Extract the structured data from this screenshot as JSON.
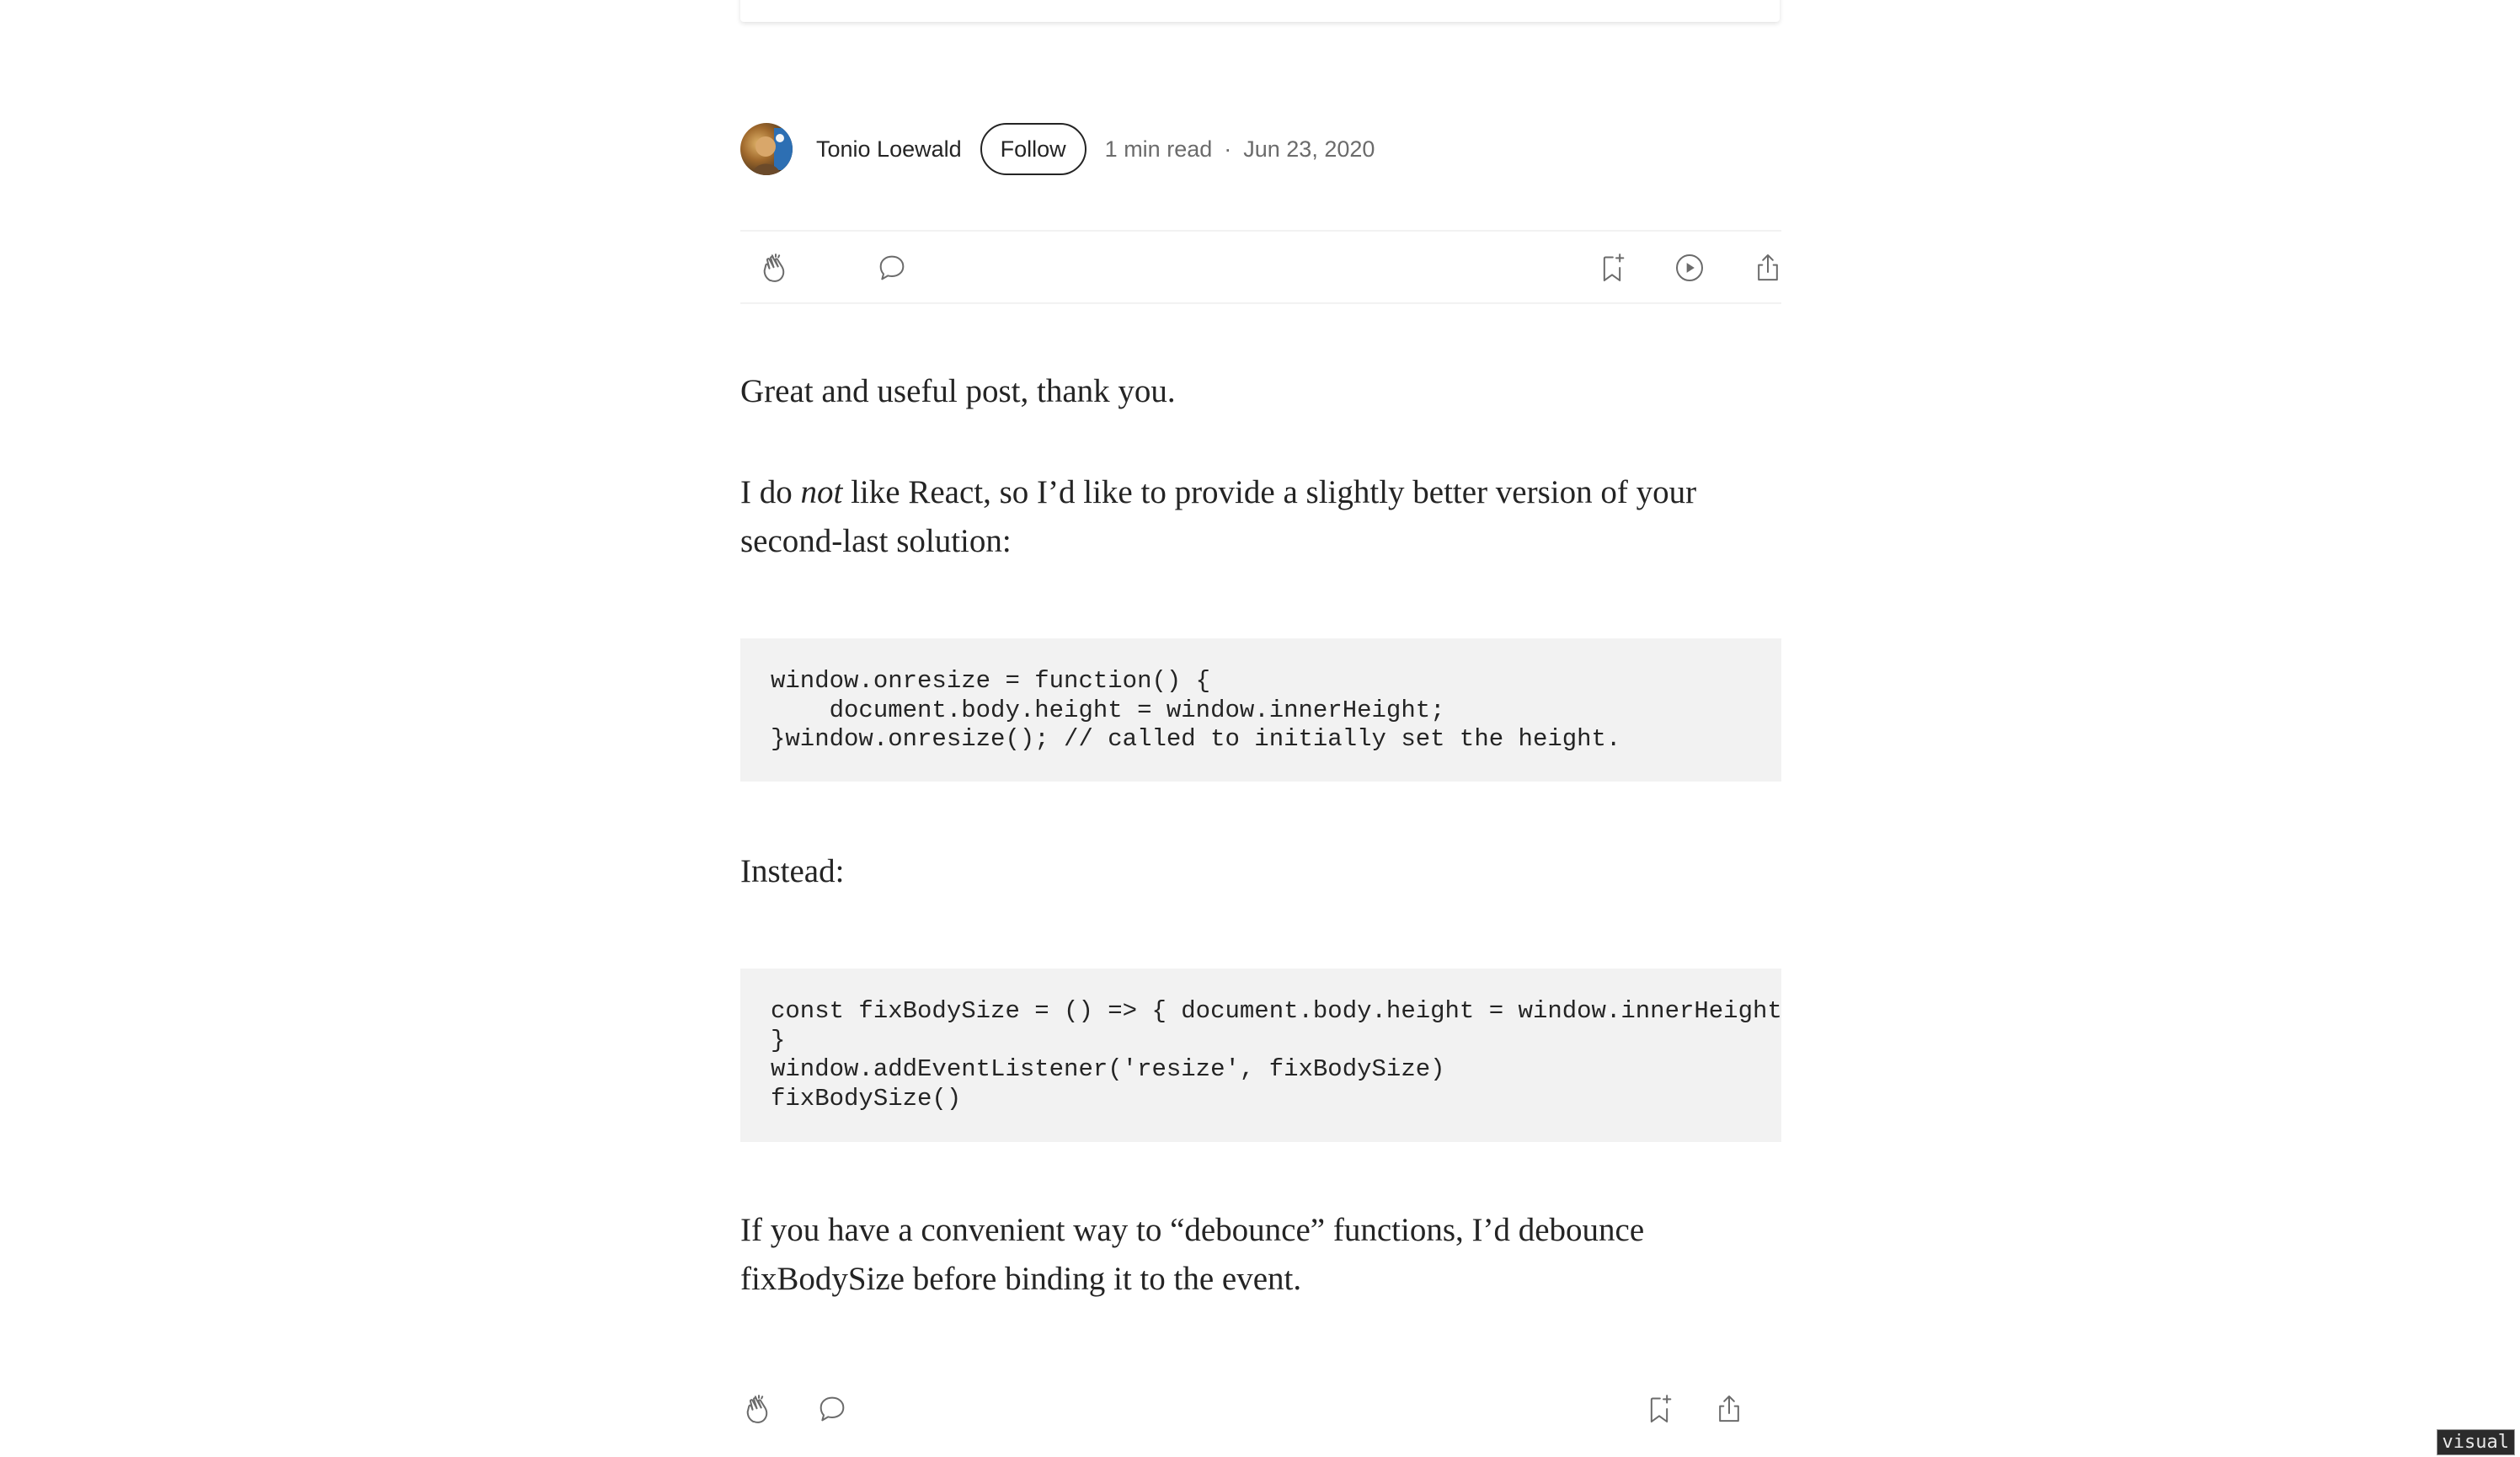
{
  "author": {
    "name": "Tonio Loewald",
    "follow_label": "Follow",
    "read_time": "1 min read",
    "separator": "·",
    "date": "Jun 23, 2020"
  },
  "actions": {
    "clap": "clap-icon",
    "respond": "comment-icon",
    "save": "bookmark-add-icon",
    "listen": "play-icon",
    "share": "share-icon"
  },
  "article": {
    "p1": "Great and useful post, thank you.",
    "p2_prefix": "I do ",
    "p2_emphasis": "not",
    "p2_suffix": " like React, so I’d like to provide a slightly better version of your second-last solution:",
    "code1": "window.onresize = function() {\n    document.body.height = window.innerHeight;\n}window.onresize(); // called to initially set the height.",
    "p3": "Instead:",
    "code2": "const fixBodySize = () => { document.body.height = window.innerHeight\n}\nwindow.addEventListener('resize', fixBodySize)\nfixBodySize()",
    "p4": "If you have a convenient way to “debounce” functions, I’d debounce fixBodySize before binding it to the event."
  },
  "overlay": {
    "badge": "visual"
  },
  "colors": {
    "text": "#242424",
    "muted": "#6b6b6b",
    "code_bg": "#f2f2f2",
    "divider": "#f2f2f2"
  }
}
